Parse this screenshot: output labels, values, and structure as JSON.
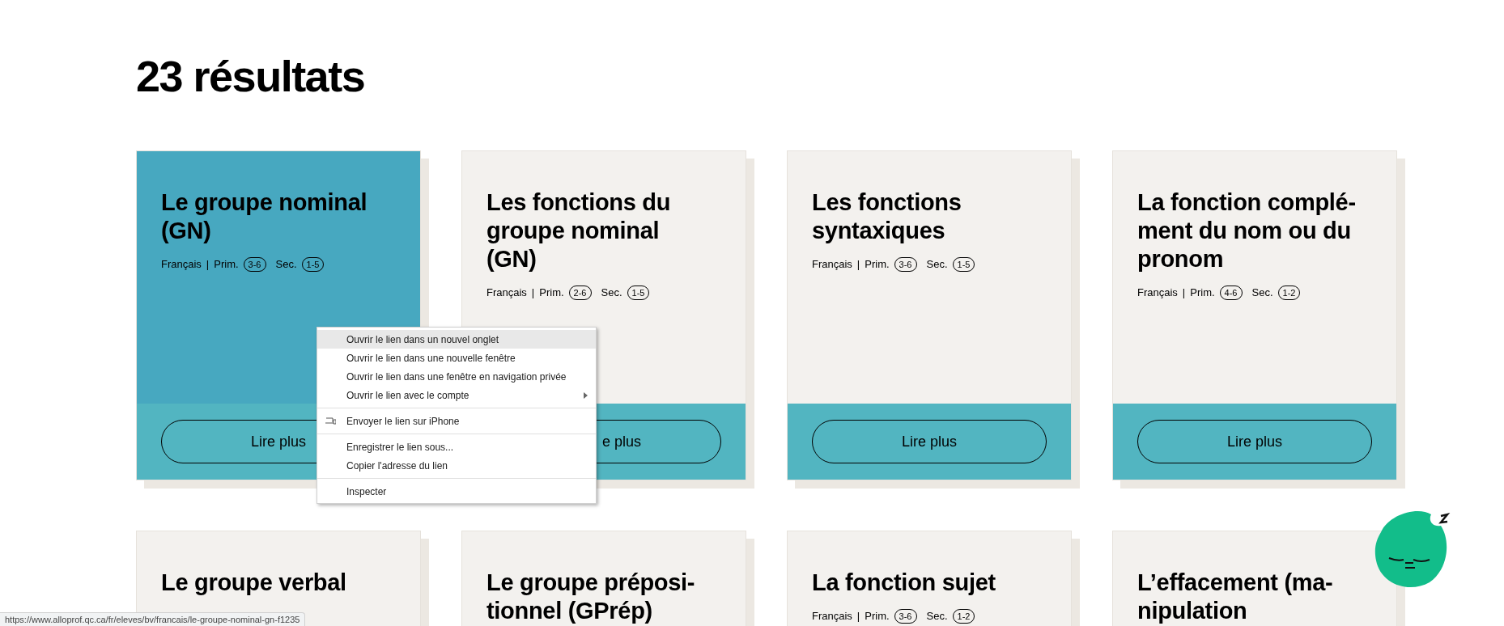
{
  "heading": "23 résultats",
  "cards": [
    {
      "title_lines": [
        "Le groupe nominal",
        "(GN)"
      ],
      "highlighted": true,
      "meta": {
        "subject": "Français",
        "separator": "|",
        "prim_label": "Prim.",
        "prim_range": "3-6",
        "sec_label": "Sec.",
        "sec_range": "1-5"
      },
      "button": "Lire plus"
    },
    {
      "title_lines": [
        "Les fonctions du",
        "groupe nominal",
        "(GN)"
      ],
      "highlighted": false,
      "meta": {
        "subject": "Français",
        "separator": "|",
        "prim_label": "Prim.",
        "prim_range": "2-6",
        "sec_label": "Sec.",
        "sec_range": "1-5"
      },
      "button": "e plus"
    },
    {
      "title_lines": [
        "Les fonctions",
        "syntaxiques"
      ],
      "highlighted": false,
      "meta": {
        "subject": "Français",
        "separator": "|",
        "prim_label": "Prim.",
        "prim_range": "3-6",
        "sec_label": "Sec.",
        "sec_range": "1-5"
      },
      "button": "Lire plus"
    },
    {
      "title_lines": [
        "La fonction complé-",
        "ment du nom ou du",
        "pronom"
      ],
      "highlighted": false,
      "meta": {
        "subject": "Français",
        "separator": "|",
        "prim_label": "Prim.",
        "prim_range": "4-6",
        "sec_label": "Sec.",
        "sec_range": "1-2"
      },
      "button": "Lire plus"
    },
    {
      "title_lines": [
        "Le groupe verbal"
      ],
      "highlighted": false
    },
    {
      "title_lines": [
        "Le groupe préposi-",
        "tionnel (GPrép)"
      ],
      "highlighted": false
    },
    {
      "title_lines": [
        "La fonction sujet"
      ],
      "highlighted": false,
      "meta": {
        "subject": "Français",
        "separator": "|",
        "prim_label": "Prim.",
        "prim_range": "3-6",
        "sec_label": "Sec.",
        "sec_range": "1-2"
      }
    },
    {
      "title_lines": [
        "L’effacement (ma-",
        "nipulation"
      ],
      "highlighted": false
    }
  ],
  "context_menu": {
    "groups": [
      [
        {
          "label": "Ouvrir le lien dans un nouvel onglet",
          "highlighted": true,
          "has_submenu": false,
          "has_icon": false
        },
        {
          "label": "Ouvrir le lien dans une nouvelle fenêtre",
          "highlighted": false,
          "has_submenu": false,
          "has_icon": false
        },
        {
          "label": "Ouvrir le lien dans une fenêtre en navigation privée",
          "highlighted": false,
          "has_submenu": false,
          "has_icon": false
        },
        {
          "label": "Ouvrir le lien avec le compte",
          "highlighted": false,
          "has_submenu": true,
          "has_icon": false
        }
      ],
      [
        {
          "label": "Envoyer le lien sur iPhone",
          "highlighted": false,
          "has_submenu": false,
          "has_icon": true
        }
      ],
      [
        {
          "label": "Enregistrer le lien sous...",
          "highlighted": false,
          "has_submenu": false,
          "has_icon": false
        },
        {
          "label": "Copier l'adresse du lien",
          "highlighted": false,
          "has_submenu": false,
          "has_icon": false
        }
      ],
      [
        {
          "label": "Inspecter",
          "highlighted": false,
          "has_submenu": false,
          "has_icon": false
        }
      ]
    ]
  },
  "status_bar": {
    "url": "https://www.alloprof.qc.ca/fr/eleves/bv/francais/le-groupe-nominal-gn-f1235"
  }
}
